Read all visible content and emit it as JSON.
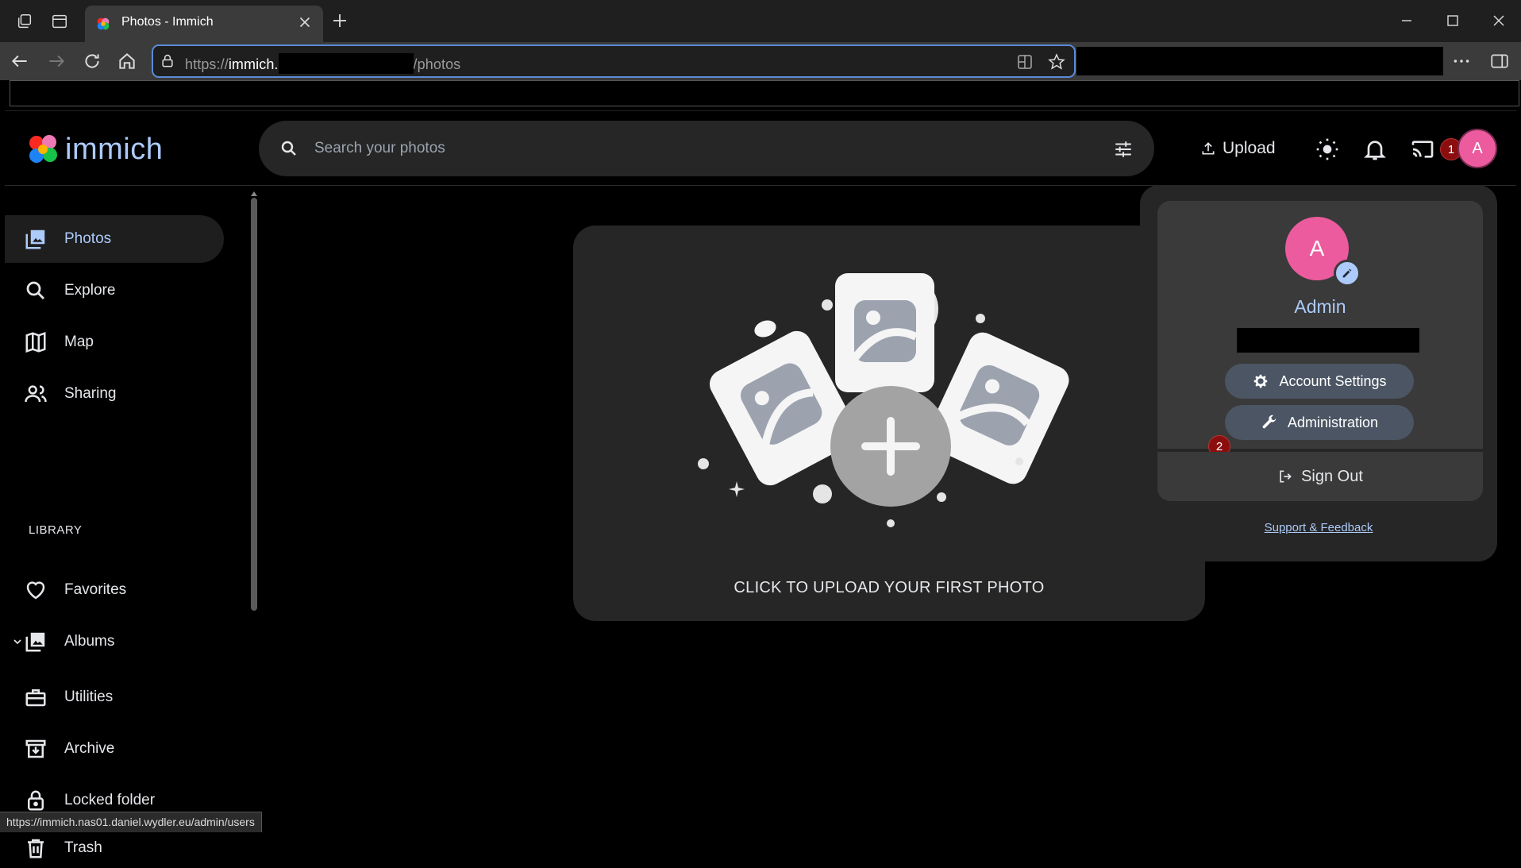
{
  "browser": {
    "tab_title": "Photos - Immich",
    "url_prefix": "https://",
    "url_host": "immich.",
    "url_path": "/photos",
    "status_url": "https://immich.nas01.daniel.wydler.eu/admin/users"
  },
  "app": {
    "logo_text": "immich",
    "search_placeholder": "Search your photos",
    "upload_label": "Upload",
    "avatar_initial": "A"
  },
  "sidebar": {
    "items": [
      {
        "label": "Photos"
      },
      {
        "label": "Explore"
      },
      {
        "label": "Map"
      },
      {
        "label": "Sharing"
      }
    ],
    "library_heading": "LIBRARY",
    "library_items": [
      {
        "label": "Favorites"
      },
      {
        "label": "Albums"
      },
      {
        "label": "Utilities"
      },
      {
        "label": "Archive"
      },
      {
        "label": "Locked folder"
      },
      {
        "label": "Trash"
      }
    ]
  },
  "main": {
    "upload_caption": "CLICK TO UPLOAD YOUR FIRST PHOTO"
  },
  "account_menu": {
    "avatar_initial": "A",
    "name": "Admin",
    "settings_label": "Account Settings",
    "admin_label": "Administration",
    "signout_label": "Sign Out",
    "support_label": "Support & Feedback"
  },
  "annotations": {
    "step1": "1",
    "step2": "2"
  },
  "colors": {
    "accent": "#adcbfa",
    "avatar": "#ec5b9d",
    "badge": "#8b0e0e"
  }
}
